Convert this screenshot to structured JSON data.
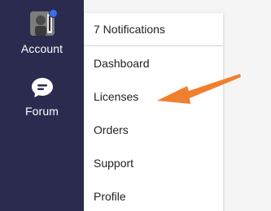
{
  "sidebar": {
    "account_label": "Account",
    "forum_label": "Forum",
    "background_color": "#2a2b4f",
    "notification_dot_color": "#3d6ef2"
  },
  "dropdown": {
    "header": "7 Notifications",
    "items": [
      {
        "label": "Dashboard"
      },
      {
        "label": "Licenses"
      },
      {
        "label": "Orders"
      },
      {
        "label": "Support"
      },
      {
        "label": "Profile"
      }
    ]
  },
  "annotation": {
    "arrow_color": "#f07f2e",
    "icon": "arrow-pointer-icon"
  }
}
